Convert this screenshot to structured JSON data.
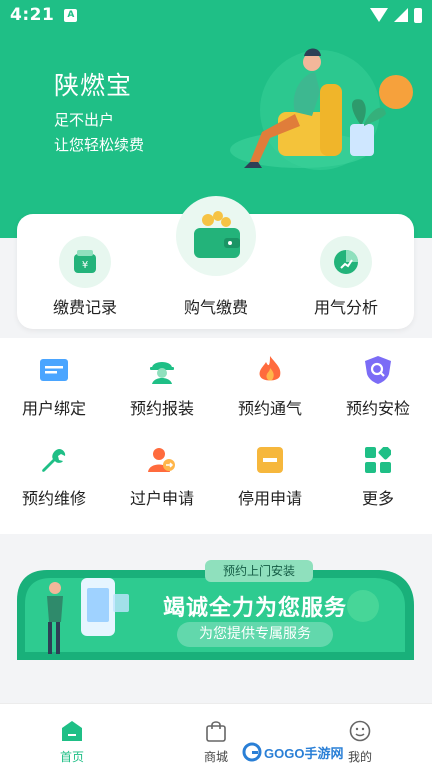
{
  "status_bar": {
    "time": "4:21",
    "indicator": "A"
  },
  "hero": {
    "title": "陕燃宝",
    "subtitle_line1": "足不出户",
    "subtitle_line2": "让您轻松续费"
  },
  "quick_actions": [
    {
      "label": "缴费记录",
      "icon": "payment-record-icon"
    },
    {
      "label": "购气缴费",
      "icon": "wallet-icon"
    },
    {
      "label": "用气分析",
      "icon": "pie-chart-icon"
    }
  ],
  "services": [
    {
      "label": "用户绑定",
      "icon": "id-card-icon"
    },
    {
      "label": "预约报装",
      "icon": "worker-icon"
    },
    {
      "label": "预约通气",
      "icon": "flame-icon"
    },
    {
      "label": "预约安检",
      "icon": "shield-search-icon"
    },
    {
      "label": "预约维修",
      "icon": "wrench-icon"
    },
    {
      "label": "过户申请",
      "icon": "transfer-users-icon"
    },
    {
      "label": "停用申请",
      "icon": "stop-icon"
    },
    {
      "label": "更多",
      "icon": "more-grid-icon"
    }
  ],
  "banner": {
    "tag": "预约上门安装",
    "title": "竭诚全力为您服务",
    "pill": "为您提供专属服务"
  },
  "bottom_nav": [
    {
      "label": "首页",
      "icon": "home-icon",
      "active": true
    },
    {
      "label": "商城",
      "icon": "shopping-bag-icon",
      "active": false
    },
    {
      "label": "我的",
      "icon": "profile-icon",
      "active": false
    }
  ],
  "watermark": {
    "text": "GOGO手游网"
  },
  "colors": {
    "primary": "#1fbf86",
    "accent_orange": "#f6a13c"
  }
}
